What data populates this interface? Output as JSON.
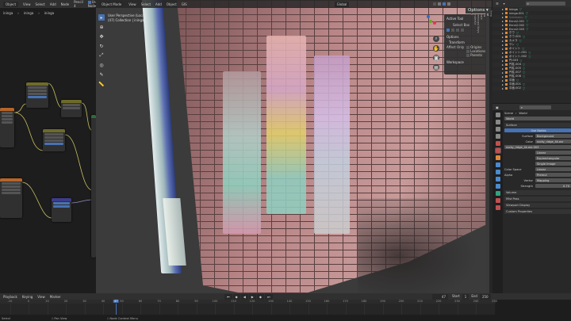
{
  "node_editor": {
    "header": {
      "editor": "Object",
      "menus": [
        "View",
        "Select",
        "Add",
        "Node"
      ],
      "pencil": "Pencil 4",
      "use_nodes": "Use Nodes"
    },
    "breadcrumb": [
      "ininga",
      "ininga",
      "ininga"
    ]
  },
  "viewport": {
    "header": {
      "mode": "Object Mode",
      "menus": [
        "View",
        "Select",
        "Add",
        "Object",
        "GIS"
      ],
      "orientation": "Global"
    },
    "overlay": {
      "line1": "User Perspective (Local)",
      "line2": "(47) Collection | ininga"
    },
    "options_label": "Options"
  },
  "npanel": {
    "active_tool": "Active Tool",
    "select_box": "Select Box",
    "options": "Options",
    "transform": "Transform",
    "affect_only": "Affect Only",
    "origins": "Origins",
    "locations": "Locations",
    "parents": "Parents",
    "workspace": "Workspace",
    "tabs": [
      "Item",
      "Tool",
      "View",
      "Create",
      "Screencast Keys",
      "BlenderKit",
      "GIS"
    ]
  },
  "outliner": {
    "items": [
      {
        "name": "ininga",
        "dim": false
      },
      {
        "name": "ininga.001",
        "dim": false
      },
      {
        "name": "Sukebanu",
        "dim": true
      },
      {
        "name": "Ennn2.001",
        "dim": false
      },
      {
        "name": "Ennn2.002",
        "dim": false
      },
      {
        "name": "Ennn2.003",
        "dim": false
      },
      {
        "name": "ホウ",
        "dim": false
      },
      {
        "name": "ホウ.001",
        "dim": false
      },
      {
        "name": "カメラ",
        "dim": false
      },
      {
        "name": "サン",
        "dim": false
      },
      {
        "name": "ポイント",
        "dim": false
      },
      {
        "name": "ポイント.001",
        "dim": false
      },
      {
        "name": "ポイント.002",
        "dim": false
      },
      {
        "name": "円.003",
        "dim": false
      },
      {
        "name": "円柱.004",
        "dim": false
      },
      {
        "name": "円柱.005",
        "dim": false
      },
      {
        "name": "円柱.007",
        "dim": false
      },
      {
        "name": "円柱.008",
        "dim": false
      },
      {
        "name": "平面",
        "dim": false
      },
      {
        "name": "平面.001",
        "dim": false
      },
      {
        "name": "平面.002",
        "dim": false
      }
    ]
  },
  "properties": {
    "breadcrumb_scene": "Scene",
    "breadcrumb_world": "World",
    "world_name": "World",
    "surface": "Surface",
    "use_nodes": "Use Nodes",
    "surface_label": "Surface",
    "surface_value": "Background",
    "color_label": "Color",
    "color_value": "rocky_ridge_4k.exr",
    "image_name": "rocky_ridge_4k.exr.003",
    "interp": "Linear",
    "projection": "Equirectangular",
    "source": "Single Image",
    "color_space_label": "Color Space",
    "color_space": "Linear",
    "alpha_label": "Alpha",
    "alpha": "Premul",
    "vector_label": "Vector",
    "vector": "Mapping",
    "strength_label": "Strength",
    "strength": "0.70",
    "panels": [
      "Volume",
      "Mist Pass",
      "Viewport Display",
      "Custom Properties"
    ]
  },
  "timeline": {
    "menus": [
      "Playback",
      "Keying",
      "View",
      "Marker"
    ],
    "current_frame": 47,
    "start_label": "Start",
    "start": "1",
    "end_label": "End",
    "end": "250",
    "ticks": [
      -10,
      0,
      10,
      20,
      30,
      40,
      50,
      60,
      70,
      80,
      90,
      100,
      110,
      120,
      130,
      140,
      150,
      160,
      170,
      180,
      190,
      200,
      210,
      220,
      230,
      240,
      250
    ]
  },
  "status": {
    "select": "Select",
    "pan": "Pan View",
    "context": "Node Context Menu"
  },
  "colors": {
    "accent": "#4772b3",
    "wall": "#b88586"
  }
}
